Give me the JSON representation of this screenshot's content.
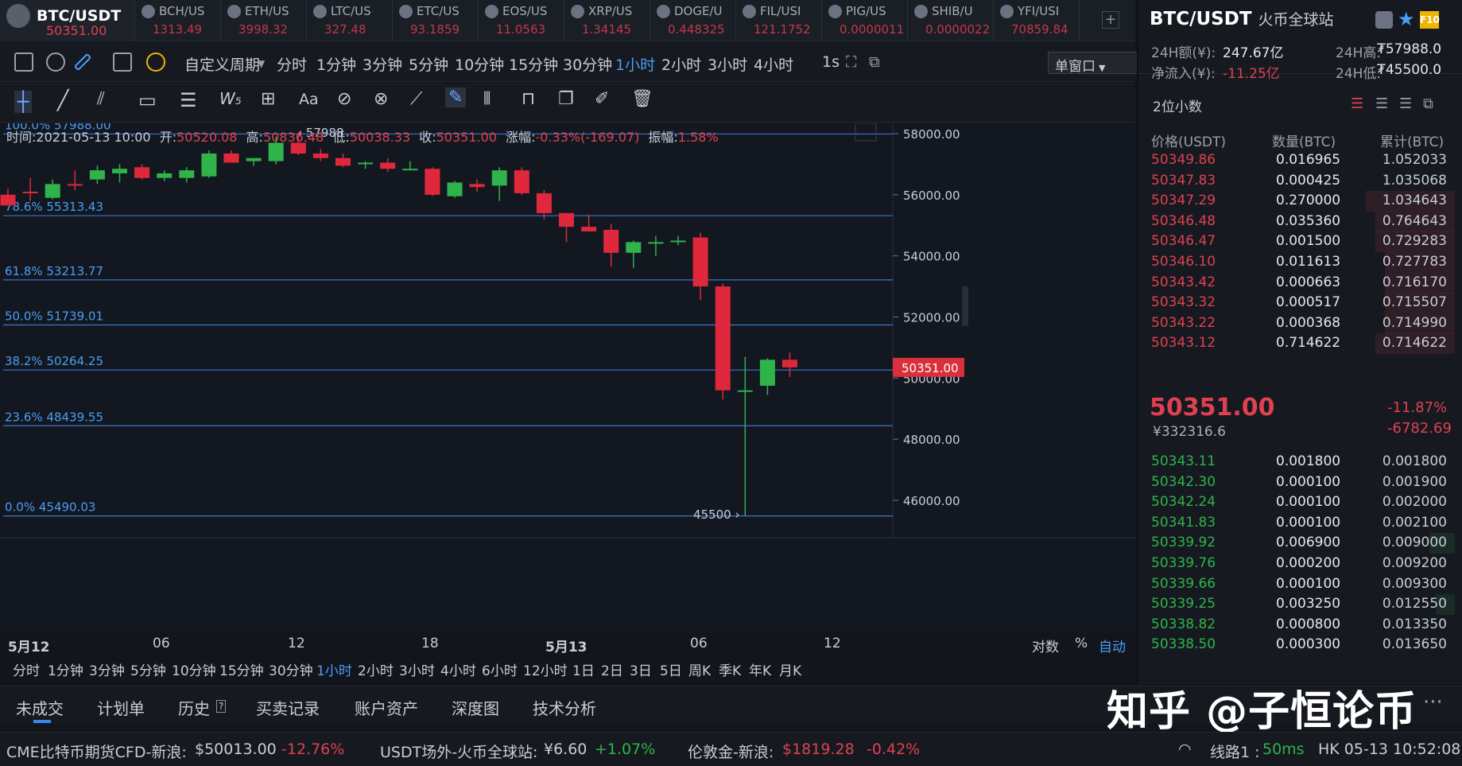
{
  "tickers": [
    {
      "name": "BTC/USDT",
      "price": "50351.00"
    },
    {
      "name": "BCH/US",
      "price": "1313.49"
    },
    {
      "name": "ETH/US",
      "price": "3998.32"
    },
    {
      "name": "LTC/US",
      "price": "327.48"
    },
    {
      "name": "ETC/US",
      "price": "93.1859"
    },
    {
      "name": "EOS/US",
      "price": "11.0563"
    },
    {
      "name": "XRP/US",
      "price": "1.34145"
    },
    {
      "name": "DOGE/U",
      "price": "0.448325"
    },
    {
      "name": "FIL/USI",
      "price": "121.1752"
    },
    {
      "name": "PIG/US",
      "price": "0.0000011"
    },
    {
      "name": "SHIB/U",
      "price": "0.0000022"
    },
    {
      "name": "YFI/USI",
      "price": "70859.84"
    }
  ],
  "add_label": "+",
  "toolbar": {
    "custom_period": "自定义周期",
    "periods": [
      "分时",
      "1分钟",
      "3分钟",
      "5分钟",
      "10分钟",
      "15分钟",
      "30分钟",
      "1小时",
      "2小时",
      "3小时",
      "4小时"
    ],
    "active_period": "1小时",
    "refresh": "1s",
    "window": "单窗口",
    "text_tool": "Aa"
  },
  "info": {
    "time_label": "时间:",
    "time": "2021-05-13 10:00",
    "open_label": "开:",
    "open": "50520.08",
    "high_label": "高:",
    "high": "50836.48",
    "low_label": "低:",
    "low": "50038.33",
    "close_label": "收:",
    "close": "50351.00",
    "chg_label": "涨幅:",
    "chg": "-0.33%(-169.07)",
    "amp_label": "振幅:",
    "amp": "1.58%"
  },
  "fib_levels": [
    {
      "label": "100.0% 57988.00",
      "value": 57988
    },
    {
      "label": "78.6% 55313.43",
      "value": 55313.43
    },
    {
      "label": "61.8% 53213.77",
      "value": 53213.77
    },
    {
      "label": "50.0% 51739.01",
      "value": 51739.01
    },
    {
      "label": "38.2% 50264.25",
      "value": 50264.25
    },
    {
      "label": "23.6% 48439.55",
      "value": 48439.55
    },
    {
      "label": "0.0% 45490.03",
      "value": 45490.03
    }
  ],
  "marks": {
    "high": "57988",
    "low": "45500"
  },
  "chart_data": {
    "type": "candlestick",
    "y_ticks": [
      "58000.00",
      "56000.00",
      "54000.00",
      "52000.00",
      "50000.00",
      "48000.00",
      "46000.00"
    ],
    "ylim": [
      44800,
      58800
    ],
    "last_price_label": "50351.00",
    "x_ticks": [
      "5月12",
      "06",
      "12",
      "18",
      "5月13",
      "06",
      "12"
    ],
    "candles": [
      {
        "o": 56000,
        "h": 56200,
        "l": 55700,
        "c": 55650
      },
      {
        "o": 56100,
        "h": 56550,
        "l": 55800,
        "c": 56050
      },
      {
        "o": 55900,
        "h": 56500,
        "l": 55850,
        "c": 56350
      },
      {
        "o": 56350,
        "h": 56800,
        "l": 56150,
        "c": 56300
      },
      {
        "o": 56500,
        "h": 56950,
        "l": 56350,
        "c": 56800
      },
      {
        "o": 56700,
        "h": 57000,
        "l": 56400,
        "c": 56850
      },
      {
        "o": 56900,
        "h": 57000,
        "l": 56500,
        "c": 56550
      },
      {
        "o": 56550,
        "h": 56800,
        "l": 56450,
        "c": 56700
      },
      {
        "o": 56550,
        "h": 56900,
        "l": 56400,
        "c": 56800
      },
      {
        "o": 56600,
        "h": 57450,
        "l": 56550,
        "c": 57350
      },
      {
        "o": 57350,
        "h": 57450,
        "l": 57050,
        "c": 57050
      },
      {
        "o": 57100,
        "h": 57200,
        "l": 56950,
        "c": 57200
      },
      {
        "o": 57100,
        "h": 57900,
        "l": 57000,
        "c": 57700
      },
      {
        "o": 57700,
        "h": 57988,
        "l": 57300,
        "c": 57350
      },
      {
        "o": 57350,
        "h": 57500,
        "l": 57100,
        "c": 57200
      },
      {
        "o": 57200,
        "h": 57350,
        "l": 56900,
        "c": 56950
      },
      {
        "o": 57000,
        "h": 57100,
        "l": 56850,
        "c": 57050
      },
      {
        "o": 57050,
        "h": 57200,
        "l": 56750,
        "c": 56850
      },
      {
        "o": 56850,
        "h": 57100,
        "l": 56800,
        "c": 56850
      },
      {
        "o": 56850,
        "h": 56900,
        "l": 55950,
        "c": 56000
      },
      {
        "o": 55950,
        "h": 56450,
        "l": 55900,
        "c": 56400
      },
      {
        "o": 56350,
        "h": 56500,
        "l": 56100,
        "c": 56250
      },
      {
        "o": 56300,
        "h": 56900,
        "l": 55800,
        "c": 56800
      },
      {
        "o": 56800,
        "h": 56900,
        "l": 56000,
        "c": 56050
      },
      {
        "o": 56050,
        "h": 56150,
        "l": 55200,
        "c": 55400
      },
      {
        "o": 55400,
        "h": 55400,
        "l": 54450,
        "c": 54950
      },
      {
        "o": 54950,
        "h": 55350,
        "l": 54800,
        "c": 54800
      },
      {
        "o": 54850,
        "h": 55050,
        "l": 53650,
        "c": 54100
      },
      {
        "o": 54100,
        "h": 54500,
        "l": 53600,
        "c": 54450
      },
      {
        "o": 54450,
        "h": 54650,
        "l": 54000,
        "c": 54450
      },
      {
        "o": 54450,
        "h": 54650,
        "l": 54350,
        "c": 54500
      },
      {
        "o": 54600,
        "h": 54750,
        "l": 52550,
        "c": 53000
      },
      {
        "o": 53000,
        "h": 53100,
        "l": 49300,
        "c": 49600
      },
      {
        "o": 49600,
        "h": 50700,
        "l": 45500,
        "c": 49600
      },
      {
        "o": 49750,
        "h": 50650,
        "l": 49450,
        "c": 50600
      },
      {
        "o": 50600,
        "h": 50836,
        "l": 50038,
        "c": 50351
      }
    ]
  },
  "axis_opts": {
    "log": "对数",
    "pct": "%",
    "auto": "自动"
  },
  "period_bar": [
    "分时",
    "1分钟",
    "3分钟",
    "5分钟",
    "10分钟",
    "15分钟",
    "30分钟",
    "1小时",
    "2小时",
    "3小时",
    "4小时",
    "6小时",
    "12小时",
    "1日",
    "2日",
    "3日",
    "5日",
    "周K",
    "季K",
    "年K",
    "月K"
  ],
  "tabs": [
    "未成交",
    "计划单",
    "历史",
    "买卖记录",
    "账户资产",
    "深度图",
    "技术分析"
  ],
  "watermark": "知乎 @子恒论币",
  "more": "···",
  "status": {
    "s1_label": "CME比特币期货CFD-新浪:",
    "s1_val": "$50013.00",
    "s1_chg": "-12.76%",
    "s2_label": "USDT场外-火币全球站:",
    "s2_val": "¥6.60",
    "s2_chg": "+1.07%",
    "s3_label": "伦敦金-新浪:",
    "s3_val": "$1819.28",
    "s3_chg": "-0.42%",
    "line": "线路1 :",
    "latency": "50ms",
    "time": "HK 05-13 10:52:08"
  },
  "right": {
    "pair": "BTC/USDT",
    "exchange": "火币全球站",
    "vol_label": "24H额(¥):",
    "vol": "247.67亿",
    "high_label": "24H高:",
    "high": "₮57988.0",
    "flow_label": "净流入(¥):",
    "flow": "-11.25亿",
    "low_label": "24H低:",
    "low": "₮45500.0",
    "decimals": "2位小数",
    "col_price": "价格(USDT)",
    "col_amt": "数量(BTC)",
    "col_cum": "累计(BTC)",
    "asks": [
      {
        "p": "50349.86",
        "a": "0.016965",
        "c": "1.052033",
        "w": 0.0
      },
      {
        "p": "50347.83",
        "a": "0.000425",
        "c": "1.035068",
        "w": 0.0
      },
      {
        "p": "50347.29",
        "a": "0.270000",
        "c": "1.034643",
        "w": 0.28
      },
      {
        "p": "50346.48",
        "a": "0.035360",
        "c": "0.764643",
        "w": 0.25
      },
      {
        "p": "50346.47",
        "a": "0.001500",
        "c": "0.729283",
        "w": 0.25
      },
      {
        "p": "50346.10",
        "a": "0.011613",
        "c": "0.727783",
        "w": 0.22
      },
      {
        "p": "50343.42",
        "a": "0.000663",
        "c": "0.716170",
        "w": 0.22
      },
      {
        "p": "50343.32",
        "a": "0.000517",
        "c": "0.715507",
        "w": 0.22
      },
      {
        "p": "50343.22",
        "a": "0.000368",
        "c": "0.714990",
        "w": 0.22
      },
      {
        "p": "50343.12",
        "a": "0.714622",
        "c": "0.714622",
        "w": 0.25
      }
    ],
    "last": "50351.00",
    "last_cny": "¥332316.6",
    "chg_pct": "-11.87%",
    "chg_abs": "-6782.69",
    "bids": [
      {
        "p": "50343.11",
        "a": "0.001800",
        "c": "0.001800",
        "w": 0.0
      },
      {
        "p": "50342.30",
        "a": "0.000100",
        "c": "0.001900",
        "w": 0.0
      },
      {
        "p": "50342.24",
        "a": "0.000100",
        "c": "0.002000",
        "w": 0.0
      },
      {
        "p": "50341.83",
        "a": "0.000100",
        "c": "0.002100",
        "w": 0.0
      },
      {
        "p": "50339.92",
        "a": "0.006900",
        "c": "0.009000",
        "w": 0.08
      },
      {
        "p": "50339.76",
        "a": "0.000200",
        "c": "0.009200",
        "w": 0.0
      },
      {
        "p": "50339.66",
        "a": "0.000100",
        "c": "0.009300",
        "w": 0.0
      },
      {
        "p": "50339.25",
        "a": "0.003250",
        "c": "0.012550",
        "w": 0.06
      },
      {
        "p": "50338.82",
        "a": "0.000800",
        "c": "0.013350",
        "w": 0.0
      },
      {
        "p": "50338.50",
        "a": "0.000300",
        "c": "0.013650",
        "w": 0.0
      }
    ]
  },
  "colors": {
    "up": "#2fb34a",
    "down": "#e0283c",
    "accent": "#4a9df5",
    "fib": "#3b74c8"
  }
}
